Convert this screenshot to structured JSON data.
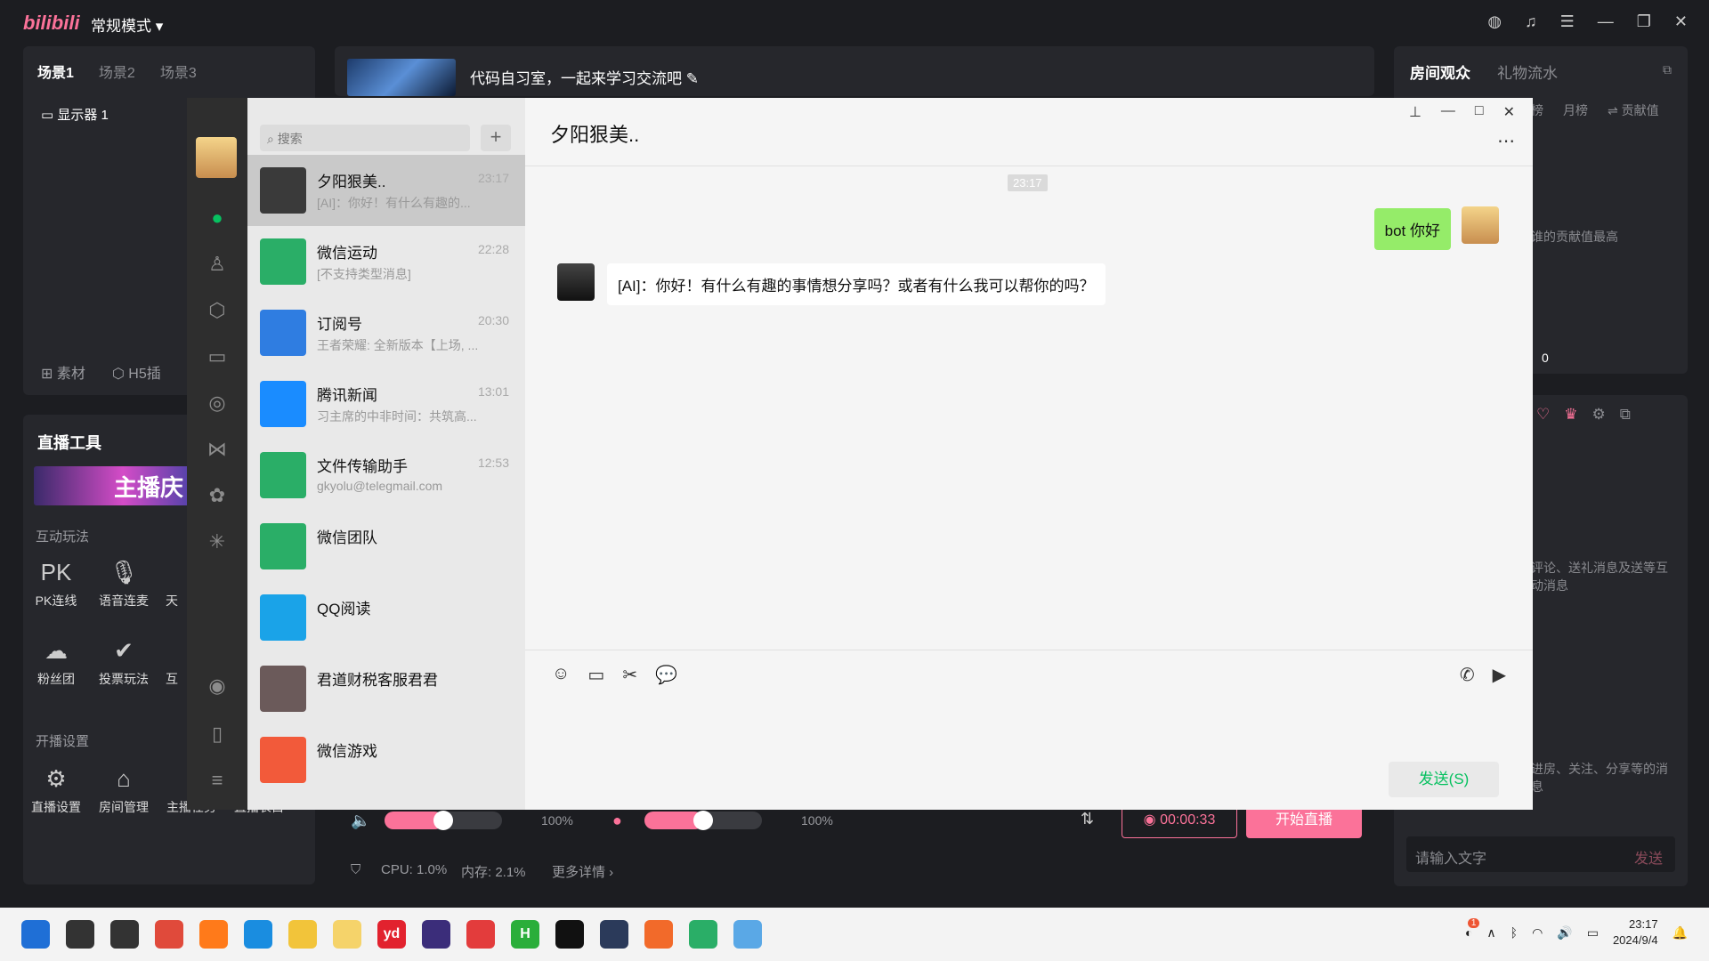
{
  "topbar": {
    "logo": "bilibili",
    "mode": "常规模式 ▾"
  },
  "scenes": {
    "tabs": [
      "场景1",
      "场景2",
      "场景3"
    ],
    "display": "显示器 1",
    "footer": [
      "素材",
      "H5插"
    ]
  },
  "tools": {
    "title": "直播工具",
    "banner": "主播庆",
    "section_interact": "互动玩法",
    "interact": [
      {
        "label": "PK连线",
        "icon": "pk-icon"
      },
      {
        "label": "语音连麦",
        "icon": "mic-icon"
      },
      {
        "label": "天",
        "icon": "sky-icon"
      },
      {
        "label": "粉丝团",
        "icon": "fans-icon"
      },
      {
        "label": "投票玩法",
        "icon": "vote-icon"
      },
      {
        "label": "互",
        "icon": "hu-icon"
      }
    ],
    "section_start": "开播设置",
    "start": [
      {
        "label": "直播设置",
        "icon": "settings-icon"
      },
      {
        "label": "房间管理",
        "icon": "room-icon"
      },
      {
        "label": "主播任务",
        "icon": "task-icon"
      },
      {
        "label": "直播表白",
        "icon": "confess-icon"
      }
    ]
  },
  "room": {
    "title": "代码自习室，一起来学习交流吧"
  },
  "controls": {
    "volume": "100%",
    "mic": "100%",
    "volume_level": 0.5,
    "mic_level": 0.5,
    "timer": "00:00:33",
    "start": "开始直播"
  },
  "status": {
    "cpu": "CPU: 1.0%",
    "mem": "内存: 2.1%",
    "more": "更多详情"
  },
  "right": {
    "tabs": [
      "房间观众",
      "礼物流水"
    ],
    "subtabs": [
      "榜",
      "月榜",
      "贡献值"
    ],
    "note1": "谁的贡献值最高",
    "count": "0",
    "note2": "评论、送礼消息及送等互动消息",
    "note3": "进房、关注、分享等的消息",
    "input_placeholder": "请输入文字",
    "send": "发送"
  },
  "wechat": {
    "search_placeholder": "搜索",
    "plus": "+",
    "conversations": [
      {
        "name": "夕阳狠美..",
        "preview": "[AI]：你好！有什么有趣的...",
        "time": "23:17",
        "color": "#3a3a3a",
        "active": true
      },
      {
        "name": "微信运动",
        "preview": "[不支持类型消息]",
        "time": "22:28",
        "color": "#2aae67"
      },
      {
        "name": "订阅号",
        "preview": "王者荣耀: 全新版本【上场, ...",
        "time": "20:30",
        "color": "#2f7de1"
      },
      {
        "name": "腾讯新闻",
        "preview": "习主席的中非时间：共筑高...",
        "time": "13:01",
        "color": "#1a8cff"
      },
      {
        "name": "文件传输助手",
        "preview": "gkyolu@telegmail.com",
        "time": "12:53",
        "color": "#2aae67"
      },
      {
        "name": "微信团队",
        "preview": "",
        "time": "",
        "color": "#2aae67"
      },
      {
        "name": "QQ阅读",
        "preview": "",
        "time": "",
        "color": "#1aa3e8"
      },
      {
        "name": "君道财税客服君君",
        "preview": "",
        "time": "",
        "color": "#6b5a5a"
      },
      {
        "name": "微信游戏",
        "preview": "",
        "time": "",
        "color": "#f25a3a"
      }
    ],
    "chat_title": "夕阳狠美..",
    "timestamp": "23:17",
    "msg_me": "bot 你好",
    "msg_ai": "[AI]：你好！有什么有趣的事情想分享吗？或者有什么我可以帮你的吗？",
    "send": "发送(S)"
  },
  "taskbar": {
    "apps": [
      {
        "icon": "start-icon",
        "label": "",
        "color": "#1f6fd6"
      },
      {
        "icon": "search-icon",
        "label": "",
        "color": "#333"
      },
      {
        "icon": "task-view-icon",
        "label": "",
        "color": "#333"
      },
      {
        "icon": "chrome-icon",
        "label": "",
        "color": "#e04a3b"
      },
      {
        "icon": "firefox-icon",
        "label": "",
        "color": "#ff7a1a"
      },
      {
        "icon": "edge-icon",
        "label": "",
        "color": "#1a8de0"
      },
      {
        "icon": "folder-icon",
        "label": "",
        "color": "#f2c43a"
      },
      {
        "icon": "app-icon",
        "label": "",
        "color": "#f5d36a"
      },
      {
        "icon": "youdao-icon",
        "label": "yd",
        "color": "#e2222e"
      },
      {
        "icon": "jetbrains-icon",
        "label": "",
        "color": "#3b2d7a"
      },
      {
        "icon": "netease-icon",
        "label": "",
        "color": "#e33c3c"
      },
      {
        "icon": "hbuilder-icon",
        "label": "H",
        "color": "#2aae3a"
      },
      {
        "icon": "qq-icon",
        "label": "",
        "color": "#111"
      },
      {
        "icon": "cat-icon",
        "label": "",
        "color": "#2b3a5a"
      },
      {
        "icon": "pen-icon",
        "label": "",
        "color": "#f26a2a"
      },
      {
        "icon": "wechat-icon",
        "label": "",
        "color": "#2aae67"
      },
      {
        "icon": "live-icon",
        "label": "",
        "color": "#5aa8e6"
      }
    ],
    "notify_badge": "1",
    "time": "23:17",
    "date": "2024/9/4"
  }
}
